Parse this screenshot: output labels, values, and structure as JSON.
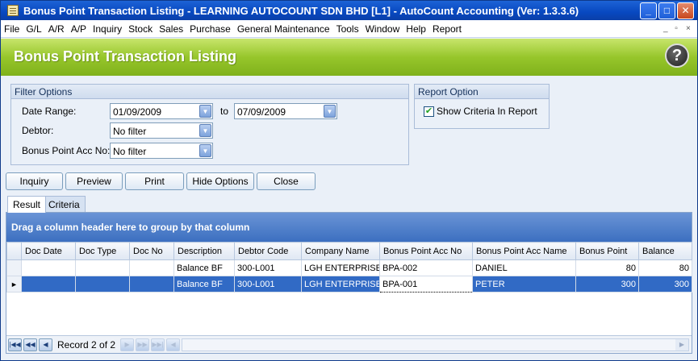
{
  "window": {
    "title": "Bonus Point Transaction Listing - LEARNING AUTOCOUNT SDN BHD [L1] - AutoCount Accounting (Ver: 1.3.3.6)",
    "buttons": [
      "_",
      "□",
      "✕"
    ]
  },
  "menu": {
    "items": [
      "File",
      "G/L",
      "A/R",
      "A/P",
      "Inquiry",
      "Stock",
      "Sales",
      "Purchase",
      "General Maintenance",
      "Tools",
      "Window",
      "Help",
      "Report"
    ],
    "mdi_buttons": [
      "_",
      "▫",
      "×"
    ]
  },
  "header": {
    "title": "Bonus Point Transaction Listing",
    "help_glyph": "?"
  },
  "filter": {
    "title": "Filter Options",
    "date_range_label": "Date Range:",
    "date_from": "01/09/2009",
    "to_label": "to",
    "date_to": "07/09/2009",
    "debtor_label": "Debtor:",
    "debtor_value": "No filter",
    "acc_label": "Bonus Point Acc No:",
    "acc_value": "No filter"
  },
  "report_option": {
    "title": "Report Option",
    "show_criteria_label": "Show Criteria In Report",
    "show_criteria_checked": true
  },
  "actions": {
    "inquiry": "Inquiry",
    "preview": "Preview",
    "print": "Print",
    "hide_options": "Hide Options",
    "close": "Close"
  },
  "tabs": {
    "result": "Result",
    "criteria": "Criteria"
  },
  "grid": {
    "group_hint": "Drag a column header here to group by that column",
    "columns": [
      "Doc Date",
      "Doc Type",
      "Doc No",
      "Description",
      "Debtor Code",
      "Company Name",
      "Bonus Point Acc No",
      "Bonus Point Acc Name",
      "Bonus Point",
      "Balance"
    ],
    "rows": [
      [
        "",
        "",
        "",
        "Balance BF",
        "300-L001",
        "LGH ENTERPRISE",
        "BPA-002",
        "DANIEL",
        "80",
        "80"
      ],
      [
        "",
        "",
        "",
        "Balance BF",
        "300-L001",
        "LGH ENTERPRISE",
        "BPA-001",
        "PETER",
        "300",
        "300"
      ]
    ],
    "selected_row_marker": "►"
  },
  "navigator": {
    "record_text": "Record 2 of 2"
  },
  "colors": {
    "header_green": "#97c62b",
    "selection_blue": "#316ac5",
    "titlebar_blue": "#0848c0"
  }
}
